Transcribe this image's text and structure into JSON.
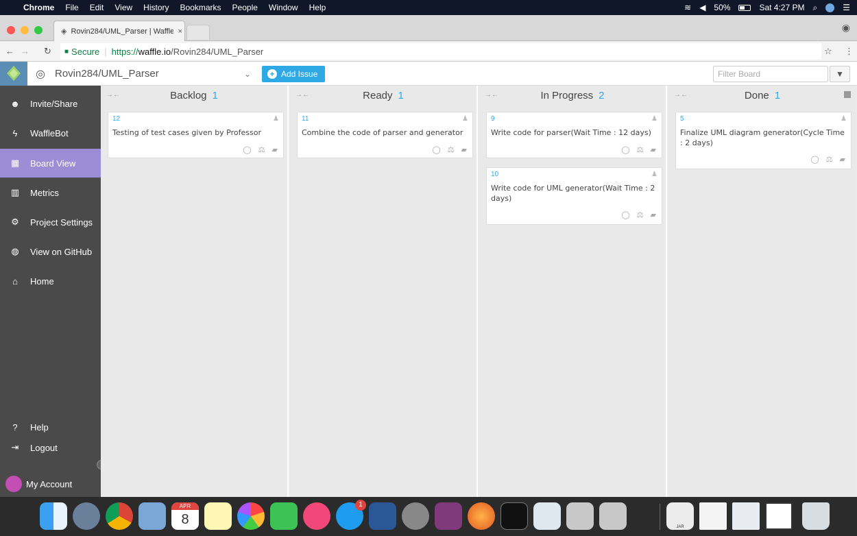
{
  "os_menubar": {
    "app": "Chrome",
    "menus": [
      "File",
      "Edit",
      "View",
      "History",
      "Bookmarks",
      "People",
      "Window",
      "Help"
    ],
    "battery": "50%",
    "clock": "Sat 4:27 PM"
  },
  "browser": {
    "tab_title": "Rovin284/UML_Parser | Waffle",
    "secure_label": "Secure",
    "url_prefix": "https://",
    "url_host": "waffle.io",
    "url_path": "/Rovin284/UML_Parser"
  },
  "waffle": {
    "project": "Rovin284/UML_Parser",
    "add_issue_label": "Add Issue",
    "filter_placeholder": "Filter Board"
  },
  "sidebar": {
    "items": [
      {
        "label": "Invite/Share",
        "icon": "users-icon"
      },
      {
        "label": "WaffleBot",
        "icon": "bolt-icon"
      },
      {
        "label": "Board View",
        "icon": "table-icon",
        "active": true
      },
      {
        "label": "Metrics",
        "icon": "bar-chart-icon"
      },
      {
        "label": "Project Settings",
        "icon": "gear-icon"
      },
      {
        "label": "View on GitHub",
        "icon": "github-icon"
      },
      {
        "label": "Home",
        "icon": "home-icon"
      }
    ],
    "bottom": [
      {
        "label": "Help",
        "icon": "question-icon"
      },
      {
        "label": "Logout",
        "icon": "logout-icon"
      },
      {
        "label": "My Account",
        "icon": "avatar"
      }
    ]
  },
  "columns": [
    {
      "title": "Backlog",
      "count": "1",
      "cards": [
        {
          "number": "12",
          "title": "Testing of test cases given by Professor"
        }
      ]
    },
    {
      "title": "Ready",
      "count": "1",
      "cards": [
        {
          "number": "11",
          "title": "Combine the code of parser and generator"
        }
      ]
    },
    {
      "title": "In Progress",
      "count": "2",
      "cards": [
        {
          "number": "9",
          "title": "Write code for parser(Wait Time : 12 days)"
        },
        {
          "number": "10",
          "title": "Write code for UML generator(Wait Time : 2 days)"
        }
      ]
    },
    {
      "title": "Done",
      "count": "1",
      "cards": [
        {
          "number": "5",
          "title": "Finalize UML diagram generator(Cycle Time : 2 days)"
        }
      ]
    }
  ],
  "dock": {
    "calendar_month": "APR",
    "calendar_day": "8",
    "appstore_badge": "1",
    "jar_label": "JAR"
  },
  "colors": {
    "accent": "#2ea9e6",
    "sidebar_bg": "#4a4a4a",
    "sidebar_active": "#9b8ed6"
  }
}
